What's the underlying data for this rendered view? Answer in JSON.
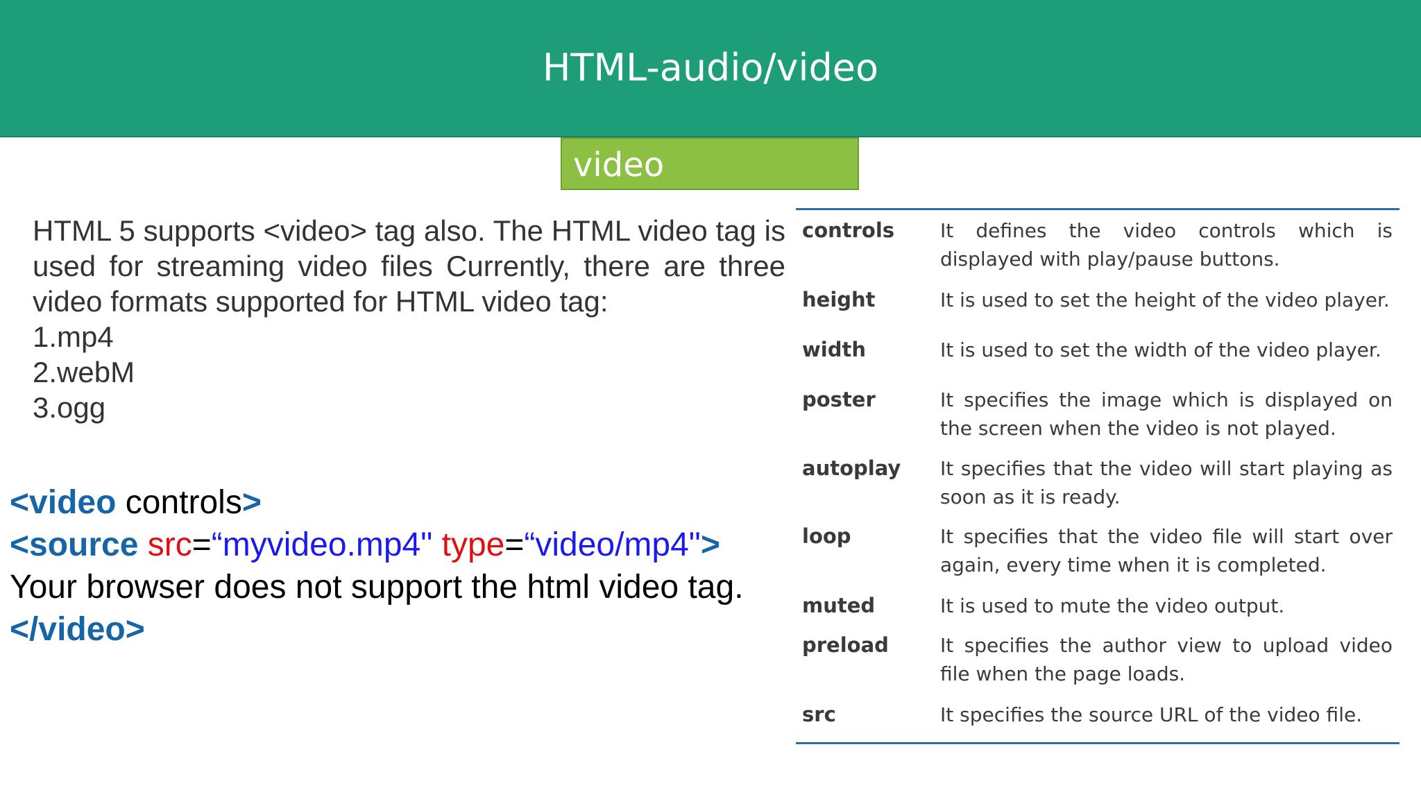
{
  "header": {
    "title": "HTML-audio/video"
  },
  "subtitle": {
    "label": "video"
  },
  "intro": {
    "paragraph": "HTML 5 supports <video> tag also. The HTML video tag is used for streaming video files Currently, there are three video formats supported for HTML video tag:",
    "formats": [
      "1.mp4",
      "2.webM",
      "3.ogg"
    ]
  },
  "code": {
    "line1_open": "<video",
    "line1_attr": " controls",
    "line1_close": ">",
    "line2_open": " <source",
    "line2_src_attr": " src",
    "line2_eq1": "=",
    "line2_src_val": "“myvideo.mp4\"",
    "line2_type_attr": " type",
    "line2_eq2": "=",
    "line2_type_val": "“video/mp4\"",
    "line2_close": ">",
    "line3": "Your browser does not support the html video tag.",
    "line4": "</video>"
  },
  "attributes": [
    {
      "name": "controls",
      "desc": "It defines the video controls which is displayed with play/pause buttons."
    },
    {
      "name": "height",
      "desc": "It is used to set the height of the video player."
    },
    {
      "name": "width",
      "desc": "It is used to set the width of the video player."
    },
    {
      "name": "poster",
      "desc": "It specifies the image which is displayed on the screen when the video is not played."
    },
    {
      "name": "autoplay",
      "desc": "It specifies that the video will start playing as soon as it is ready."
    },
    {
      "name": "loop",
      "desc": "It specifies that the video file will start over again, every time when it is completed."
    },
    {
      "name": "muted",
      "desc": "It is used to mute the video output."
    },
    {
      "name": "preload",
      "desc": "It specifies the author view to upload video file when the page loads."
    },
    {
      "name": "src",
      "desc": "It specifies the source URL of the video file."
    }
  ],
  "colors": {
    "header_bg": "#1e9e78",
    "subtitle_bg": "#8cc043",
    "tag": "#1565a8",
    "attribute": "#e01010",
    "value": "#1a1aee",
    "rule": "#2e6da4"
  }
}
